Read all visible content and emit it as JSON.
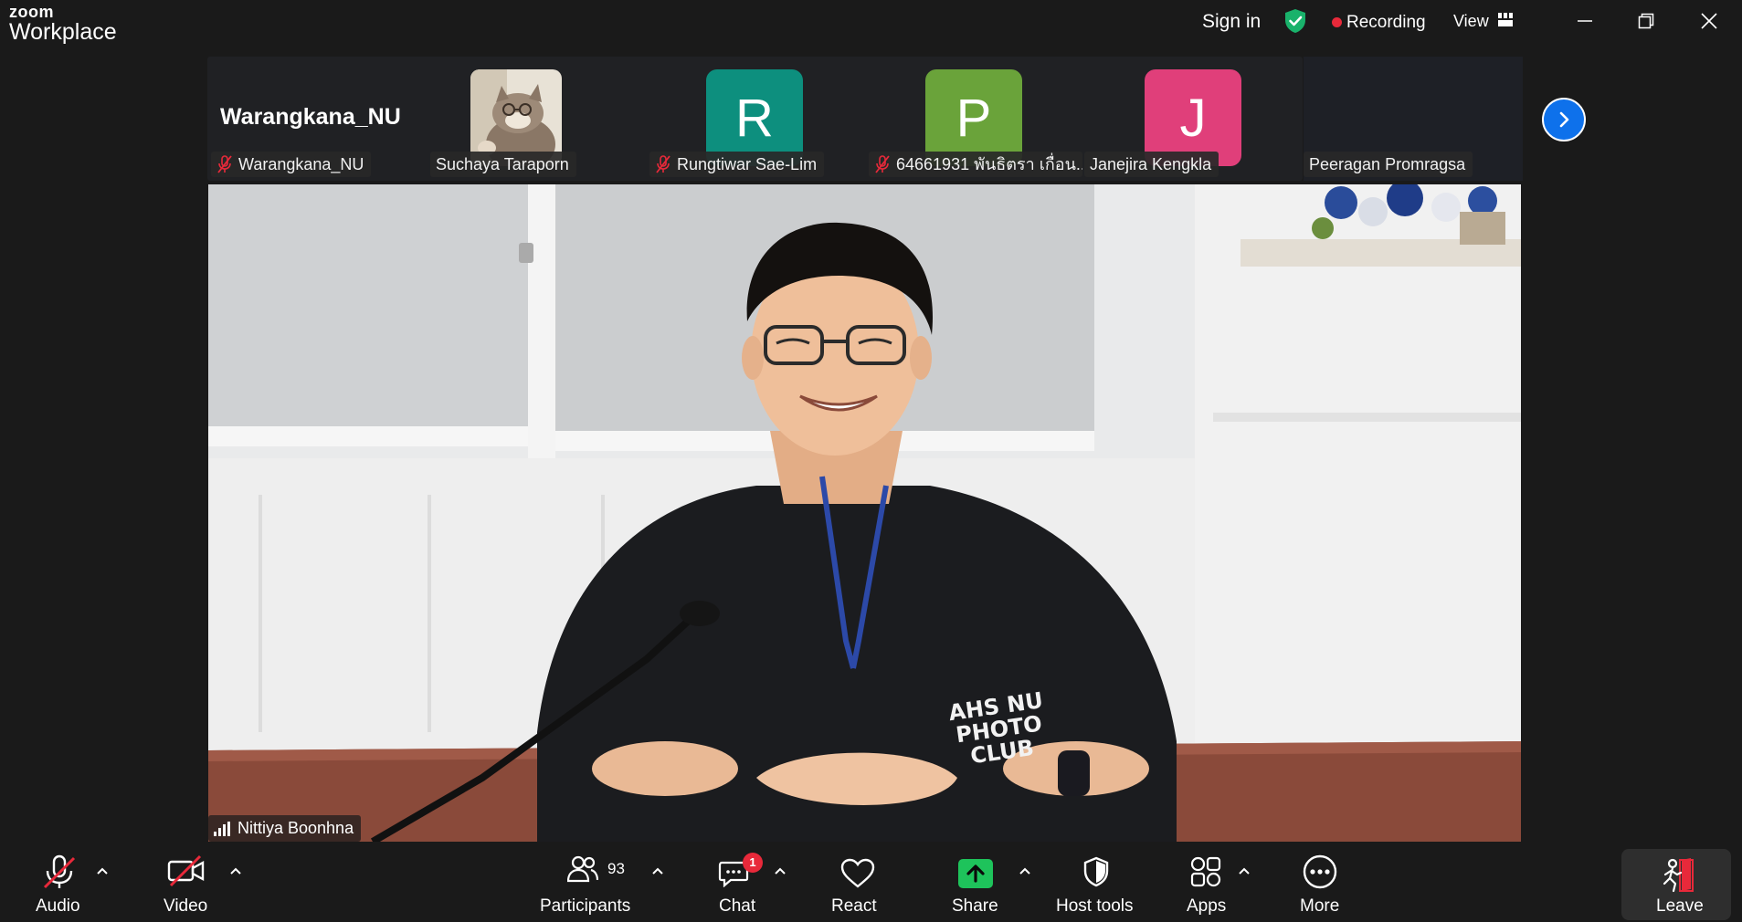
{
  "app": {
    "brand_small": "zoom",
    "brand_large": "Workplace"
  },
  "titlebar": {
    "signin_label": "Sign in",
    "recording_label": "Recording",
    "view_label": "View",
    "shield_color": "#19b26b",
    "recording_color": "#e8293a"
  },
  "strip": {
    "self_title": "Warangkana_NU",
    "participants": [
      {
        "name": "Warangkana_NU",
        "muted": true
      },
      {
        "name": "Suchaya Taraporn",
        "muted": false,
        "avatar": "cat-photo"
      },
      {
        "name": "Rungtiwar Sae-Lim",
        "muted": true,
        "initial": "R",
        "color": "#0d8f7e"
      },
      {
        "name": "64661931 พันธิตรา เกื่อน...",
        "muted": true,
        "initial": "P",
        "color": "#6aa33a"
      },
      {
        "name": "Janejira Kengkla",
        "muted": false,
        "initial": "J",
        "color": "#e03f7a"
      },
      {
        "name": "Peeragan Promragsa",
        "muted": false
      }
    ]
  },
  "main_video": {
    "speaker_name": "Nittiya Boonhna",
    "shirt_text_1": "AHS NU",
    "shirt_text_2": "PHOTO",
    "shirt_text_3": "CLUB"
  },
  "toolbar": {
    "audio_label": "Audio",
    "video_label": "Video",
    "participants_label": "Participants",
    "participants_count": "93",
    "chat_label": "Chat",
    "chat_badge": "1",
    "react_label": "React",
    "share_label": "Share",
    "host_tools_label": "Host tools",
    "apps_label": "Apps",
    "more_label": "More",
    "leave_label": "Leave",
    "share_color": "#1ec35b",
    "leave_accent": "#e8293a"
  }
}
